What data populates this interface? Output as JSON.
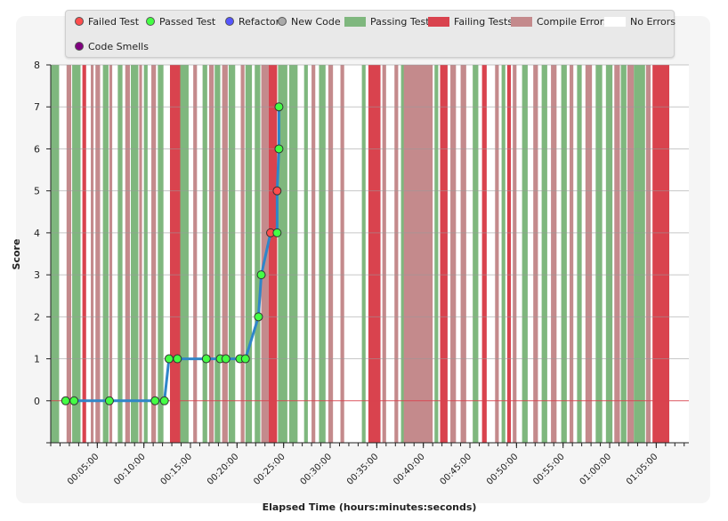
{
  "legend": {
    "items": [
      {
        "label": "Failed Test",
        "kind": "dot",
        "color": "#ff4d4d"
      },
      {
        "label": "Passed Test",
        "kind": "dot",
        "color": "#44ff44"
      },
      {
        "label": "Refactor",
        "kind": "dot",
        "color": "#5555ff"
      },
      {
        "label": "New Code",
        "kind": "dot",
        "color": "#aaaaaa"
      },
      {
        "label": "Passing Tests",
        "kind": "swatch",
        "color": "#7fb77e"
      },
      {
        "label": "Failing Tests",
        "kind": "swatch",
        "color": "#d9434e"
      },
      {
        "label": "Compile Errors",
        "kind": "swatch",
        "color": "#c48a8c"
      },
      {
        "label": "No Errors",
        "kind": "swatch",
        "color": "#ffffff"
      },
      {
        "label": "Code Smells",
        "kind": "dot",
        "color": "#800080"
      }
    ]
  },
  "chart_data": {
    "type": "line",
    "title": "",
    "xlabel": "Elapsed Time (hours:minutes:seconds)",
    "ylabel": "Score",
    "xlim_minutes": [
      0,
      68.5
    ],
    "ylim": [
      -1,
      8
    ],
    "yticks": [
      0,
      1,
      2,
      3,
      4,
      5,
      6,
      7,
      8
    ],
    "xticks": [
      "00:05:00",
      "00:10:00",
      "00:15:00",
      "00:20:00",
      "00:25:00",
      "00:30:00",
      "00:35:00",
      "00:40:00",
      "00:45:00",
      "00:50:00",
      "00:55:00",
      "01:00:00",
      "01:05:00"
    ],
    "xtick_minutes": [
      5,
      10,
      15,
      20,
      25,
      30,
      35,
      40,
      45,
      50,
      55,
      60,
      65
    ],
    "colors": {
      "line": "#2f86c9",
      "passed": "#44ff44",
      "failed": "#ff4d4d",
      "passing_band": "#7fb77e",
      "failing_band": "#d9434e",
      "compile_band": "#c48a8c",
      "zero_line": "#d9434e"
    },
    "series": [
      {
        "points": [
          {
            "t": 1.6,
            "score": 0,
            "result": "passed"
          },
          {
            "t": 2.5,
            "score": 0,
            "result": "passed"
          },
          {
            "t": 6.3,
            "score": 0,
            "result": "passed"
          },
          {
            "t": 11.2,
            "score": 0,
            "result": "passed"
          },
          {
            "t": 12.2,
            "score": 0,
            "result": "passed"
          },
          {
            "t": 12.7,
            "score": 1,
            "result": "passed"
          },
          {
            "t": 13.6,
            "score": 1,
            "result": "passed"
          },
          {
            "t": 16.7,
            "score": 1,
            "result": "passed"
          },
          {
            "t": 18.2,
            "score": 1,
            "result": "passed"
          },
          {
            "t": 18.8,
            "score": 1,
            "result": "passed"
          },
          {
            "t": 20.3,
            "score": 1,
            "result": "passed"
          },
          {
            "t": 20.9,
            "score": 1,
            "result": "passed"
          },
          {
            "t": 22.3,
            "score": 2,
            "result": "passed"
          },
          {
            "t": 22.6,
            "score": 3,
            "result": "passed"
          },
          {
            "t": 23.6,
            "score": 4,
            "result": "failed"
          },
          {
            "t": 24.3,
            "score": 4,
            "result": "passed"
          },
          {
            "t": 24.3,
            "score": 5,
            "result": "failed"
          },
          {
            "t": 24.5,
            "score": 6,
            "result": "passed"
          },
          {
            "t": 24.5,
            "score": 7,
            "result": "passed"
          }
        ]
      }
    ],
    "bands": [
      {
        "start": 0.0,
        "end": 0.9,
        "state": "passing"
      },
      {
        "start": 1.7,
        "end": 2.2,
        "state": "compile"
      },
      {
        "start": 2.3,
        "end": 3.2,
        "state": "passing"
      },
      {
        "start": 3.4,
        "end": 3.8,
        "state": "failing"
      },
      {
        "start": 4.3,
        "end": 4.6,
        "state": "compile"
      },
      {
        "start": 4.8,
        "end": 5.3,
        "state": "compile"
      },
      {
        "start": 5.6,
        "end": 6.2,
        "state": "passing"
      },
      {
        "start": 6.3,
        "end": 6.6,
        "state": "compile"
      },
      {
        "start": 7.2,
        "end": 7.7,
        "state": "passing"
      },
      {
        "start": 8.0,
        "end": 8.5,
        "state": "compile"
      },
      {
        "start": 8.6,
        "end": 9.4,
        "state": "passing"
      },
      {
        "start": 9.5,
        "end": 9.8,
        "state": "compile"
      },
      {
        "start": 10.0,
        "end": 10.4,
        "state": "passing"
      },
      {
        "start": 10.8,
        "end": 11.3,
        "state": "compile"
      },
      {
        "start": 11.5,
        "end": 12.1,
        "state": "passing"
      },
      {
        "start": 12.8,
        "end": 13.9,
        "state": "failing"
      },
      {
        "start": 13.9,
        "end": 14.8,
        "state": "passing"
      },
      {
        "start": 15.3,
        "end": 15.7,
        "state": "compile"
      },
      {
        "start": 16.3,
        "end": 16.8,
        "state": "passing"
      },
      {
        "start": 17.0,
        "end": 17.5,
        "state": "compile"
      },
      {
        "start": 17.6,
        "end": 18.2,
        "state": "passing"
      },
      {
        "start": 18.4,
        "end": 19.0,
        "state": "compile"
      },
      {
        "start": 19.1,
        "end": 19.8,
        "state": "passing"
      },
      {
        "start": 20.4,
        "end": 20.8,
        "state": "compile"
      },
      {
        "start": 20.9,
        "end": 21.6,
        "state": "passing"
      },
      {
        "start": 21.9,
        "end": 22.5,
        "state": "passing"
      },
      {
        "start": 22.6,
        "end": 23.4,
        "state": "compile"
      },
      {
        "start": 23.4,
        "end": 24.3,
        "state": "failing"
      },
      {
        "start": 24.4,
        "end": 25.4,
        "state": "passing"
      },
      {
        "start": 25.6,
        "end": 26.5,
        "state": "passing"
      },
      {
        "start": 27.2,
        "end": 27.6,
        "state": "passing"
      },
      {
        "start": 28.0,
        "end": 28.4,
        "state": "compile"
      },
      {
        "start": 28.8,
        "end": 29.5,
        "state": "passing"
      },
      {
        "start": 29.8,
        "end": 30.3,
        "state": "compile"
      },
      {
        "start": 31.1,
        "end": 31.5,
        "state": "compile"
      },
      {
        "start": 33.4,
        "end": 33.8,
        "state": "passing"
      },
      {
        "start": 34.1,
        "end": 35.4,
        "state": "failing"
      },
      {
        "start": 35.6,
        "end": 36.0,
        "state": "compile"
      },
      {
        "start": 36.9,
        "end": 37.3,
        "state": "compile"
      },
      {
        "start": 37.6,
        "end": 38.0,
        "state": "passing"
      },
      {
        "start": 37.9,
        "end": 41.0,
        "state": "compile"
      },
      {
        "start": 41.2,
        "end": 41.6,
        "state": "passing"
      },
      {
        "start": 41.8,
        "end": 42.6,
        "state": "failing"
      },
      {
        "start": 42.9,
        "end": 43.5,
        "state": "compile"
      },
      {
        "start": 44.0,
        "end": 44.6,
        "state": "compile"
      },
      {
        "start": 45.3,
        "end": 45.9,
        "state": "passing"
      },
      {
        "start": 46.3,
        "end": 46.8,
        "state": "failing"
      },
      {
        "start": 47.7,
        "end": 48.1,
        "state": "compile"
      },
      {
        "start": 48.4,
        "end": 48.8,
        "state": "passing"
      },
      {
        "start": 49.0,
        "end": 49.4,
        "state": "failing"
      },
      {
        "start": 49.6,
        "end": 50.0,
        "state": "compile"
      },
      {
        "start": 50.6,
        "end": 51.2,
        "state": "passing"
      },
      {
        "start": 51.8,
        "end": 52.3,
        "state": "compile"
      },
      {
        "start": 52.7,
        "end": 53.3,
        "state": "passing"
      },
      {
        "start": 53.7,
        "end": 54.3,
        "state": "compile"
      },
      {
        "start": 54.8,
        "end": 55.4,
        "state": "passing"
      },
      {
        "start": 55.7,
        "end": 56.1,
        "state": "compile"
      },
      {
        "start": 56.5,
        "end": 57.0,
        "state": "passing"
      },
      {
        "start": 57.4,
        "end": 58.1,
        "state": "compile"
      },
      {
        "start": 58.5,
        "end": 59.2,
        "state": "passing"
      },
      {
        "start": 59.6,
        "end": 60.3,
        "state": "passing"
      },
      {
        "start": 60.5,
        "end": 61.1,
        "state": "compile"
      },
      {
        "start": 61.2,
        "end": 61.8,
        "state": "passing"
      },
      {
        "start": 61.9,
        "end": 62.6,
        "state": "compile"
      },
      {
        "start": 62.6,
        "end": 63.8,
        "state": "passing"
      },
      {
        "start": 63.9,
        "end": 64.4,
        "state": "compile"
      },
      {
        "start": 64.6,
        "end": 66.4,
        "state": "failing"
      }
    ]
  }
}
